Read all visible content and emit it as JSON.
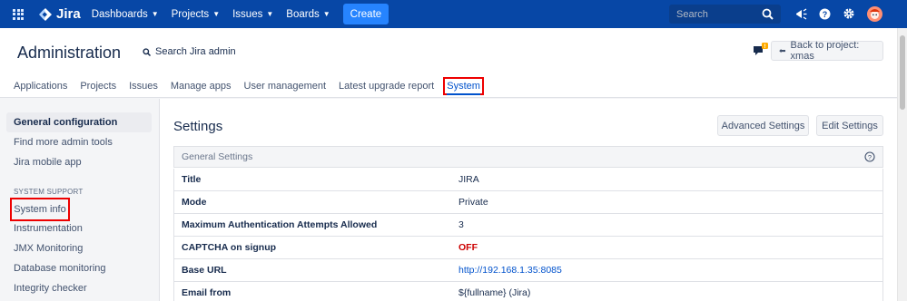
{
  "topnav": {
    "logo_text": "Jira",
    "menus": [
      "Dashboards",
      "Projects",
      "Issues",
      "Boards"
    ],
    "create_label": "Create",
    "search_placeholder": "Search",
    "icons": [
      "app-switcher-icon",
      "jira-logo-icon",
      "search-icon",
      "notifications-icon",
      "help-icon",
      "settings-icon",
      "profile-avatar-icon"
    ]
  },
  "header": {
    "title": "Administration",
    "search_label": "Search Jira admin",
    "back_button": "Back to project: xmas",
    "feedback_badge": "!",
    "tabs": [
      "Applications",
      "Projects",
      "Issues",
      "Manage apps",
      "User management",
      "Latest upgrade report",
      "System"
    ],
    "active_tab": "System"
  },
  "sidebar": {
    "items_top": [
      "General configuration",
      "Find more admin tools",
      "Jira mobile app"
    ],
    "section_heading": "SYSTEM SUPPORT",
    "items_support": [
      "System info",
      "Instrumentation",
      "JMX Monitoring",
      "Database monitoring",
      "Integrity checker"
    ]
  },
  "main": {
    "title": "Settings",
    "advanced_button": "Advanced Settings",
    "edit_button": "Edit Settings",
    "panel_title": "General Settings",
    "rows": [
      {
        "key": "Title",
        "value": "JIRA"
      },
      {
        "key": "Mode",
        "value": "Private"
      },
      {
        "key": "Maximum Authentication Attempts Allowed",
        "value": "3"
      },
      {
        "key": "CAPTCHA on signup",
        "value": "OFF"
      },
      {
        "key": "Base URL",
        "value": "http://192.168.1.35:8085"
      },
      {
        "key": "Email from",
        "value": "${fullname} (Jira)"
      }
    ]
  },
  "colors": {
    "nav_bg": "#0747a6",
    "create_btn": "#2684ff",
    "link": "#0052cc",
    "off": "#cc0000",
    "highlight": "#ee0000"
  }
}
